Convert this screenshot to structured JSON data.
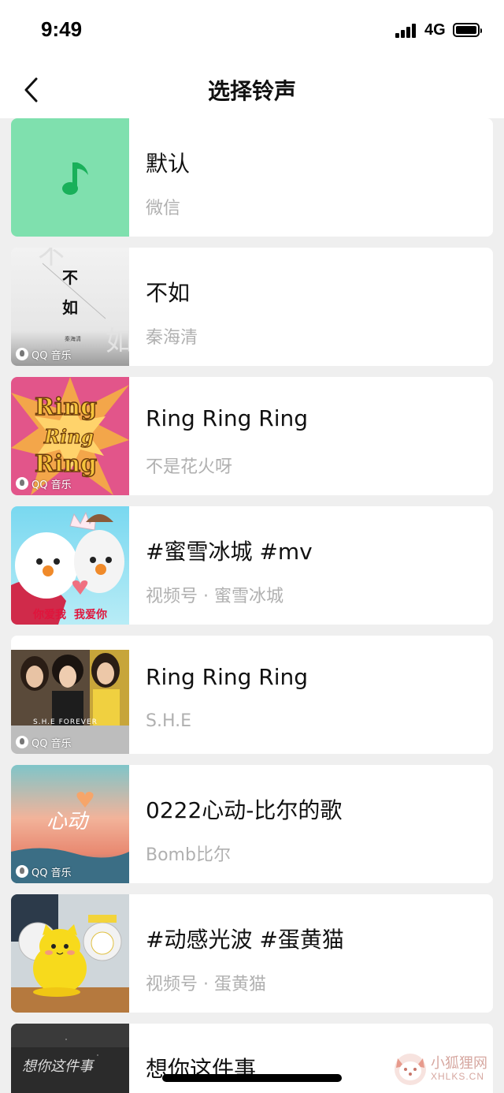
{
  "status": {
    "time": "9:49",
    "network": "4G",
    "signal_icon": "signal-bars-icon",
    "battery_icon": "battery-full-icon"
  },
  "navbar": {
    "title": "选择铃声",
    "back_icon": "chevron-left-icon"
  },
  "ringtones": [
    {
      "title": "默认",
      "subtitle": "微信",
      "thumb": "music-note-icon",
      "accent": "#7fe0ae",
      "badge": ""
    },
    {
      "title": "不如",
      "subtitle": "秦海清",
      "thumb_text_1": "不",
      "thumb_text_2": "如",
      "thumb_text_3": "秦海清",
      "badge": "QQ 音乐"
    },
    {
      "title": "Ring Ring Ring",
      "subtitle": "不是花火呀",
      "thumb_text_1": "Ring",
      "thumb_text_2": "Ring",
      "thumb_text_3": "Ring",
      "badge": "QQ 音乐"
    },
    {
      "title": "#蜜雪冰城 #mv",
      "subtitle": "视频号 · 蜜雪冰城",
      "thumb_text_1": "你爱我",
      "thumb_text_2": "我爱你",
      "badge": ""
    },
    {
      "title": "Ring Ring Ring",
      "subtitle": "S.H.E",
      "thumb_text_1": "S.H.E FOREVER",
      "badge": "QQ 音乐"
    },
    {
      "title": "0222心动-比尔的歌",
      "subtitle": "Bomb比尔",
      "thumb_text_1": "心动",
      "badge": "QQ 音乐"
    },
    {
      "title": "#动感光波 #蛋黄猫",
      "subtitle": "视频号 · 蛋黄猫",
      "badge": ""
    },
    {
      "title": "想你这件事",
      "subtitle": "",
      "thumb_text_1": "想你这件事",
      "badge": ""
    }
  ],
  "watermark": {
    "name": "小狐狸网",
    "url": "XHLKS.CN"
  }
}
